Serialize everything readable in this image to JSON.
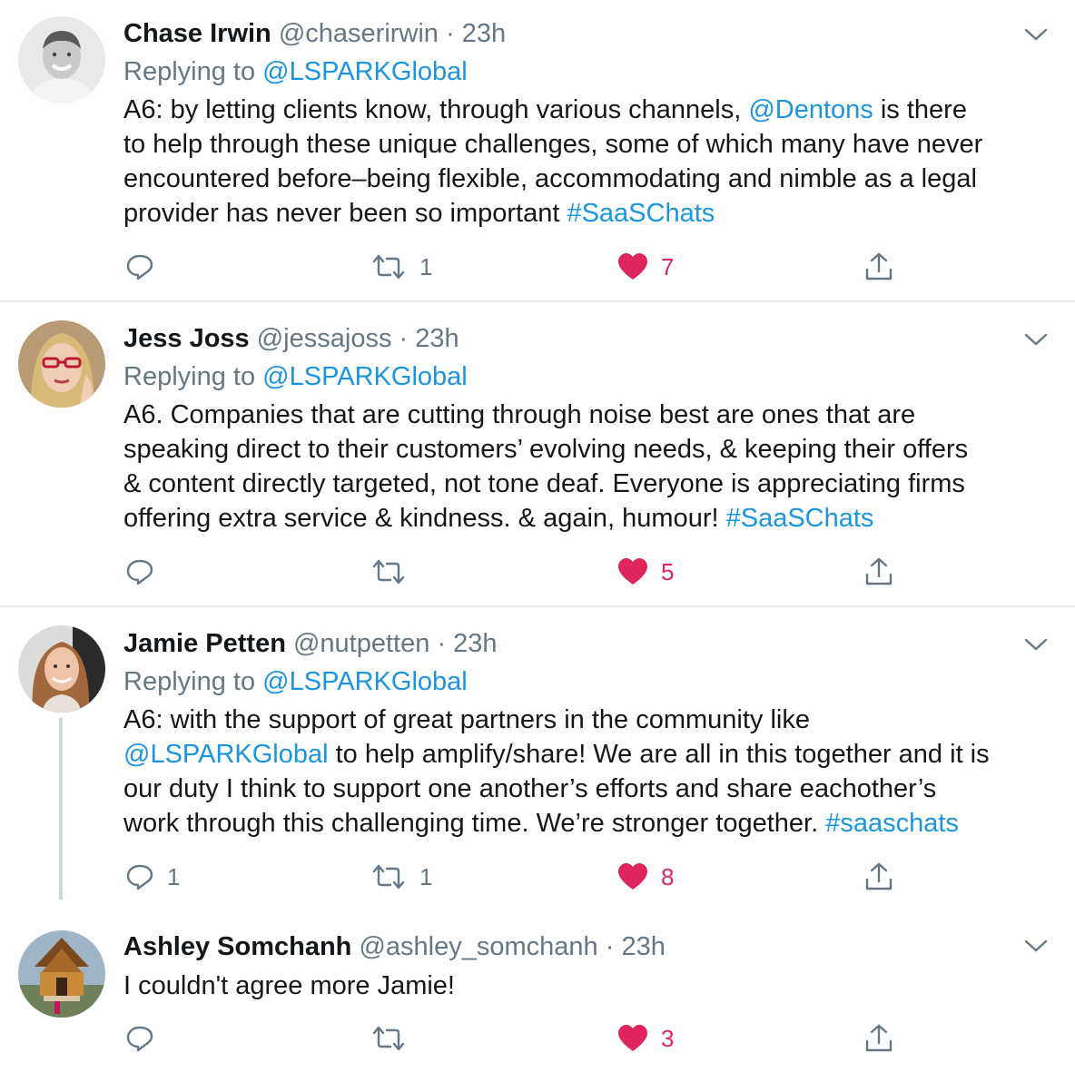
{
  "colors": {
    "link": "#1b95e0",
    "like": "#e0245e",
    "muted": "#657786",
    "divider": "#e6ecf0"
  },
  "tweets": [
    {
      "name": "Chase Irwin",
      "handle": "@chaserirwin",
      "dot": "·",
      "time": "23h",
      "replying_prefix": "Replying to ",
      "replying_handle": "@LSPARKGlobal",
      "avatar_icon": "avatar-photo-man-smiling",
      "lines": [
        [
          {
            "t": "A6: by letting clients know, through various channels, "
          },
          {
            "t": "@Dentons",
            "link": true
          },
          {
            "t": " is there"
          }
        ],
        [
          {
            "t": "to help through these unique challenges, some of which many have never"
          }
        ],
        [
          {
            "t": "encountered before–being flexible, accommodating and nimble as a legal"
          }
        ],
        [
          {
            "t": "provider has never been so important "
          },
          {
            "t": "#SaaSChats",
            "link": true
          }
        ]
      ],
      "replies": "",
      "retweets": "1",
      "likes": "7"
    },
    {
      "name": "Jess Joss",
      "handle": "@jessajoss",
      "dot": "·",
      "time": "23h",
      "replying_prefix": "Replying to ",
      "replying_handle": "@LSPARKGlobal",
      "avatar_icon": "avatar-photo-woman-red-glasses",
      "lines": [
        [
          {
            "t": "A6. Companies that are cutting through noise best are ones that are"
          }
        ],
        [
          {
            "t": "speaking direct to their customers’ evolving needs, & keeping their offers"
          }
        ],
        [
          {
            "t": "& content directly targeted, not tone deaf. Everyone is appreciating firms"
          }
        ],
        [
          {
            "t": "offering extra service & kindness. & again, humour! "
          },
          {
            "t": "#SaaSChats",
            "link": true
          }
        ]
      ],
      "replies": "",
      "retweets": "",
      "likes": "5"
    },
    {
      "name": "Jamie Petten",
      "handle": "@nutpetten",
      "dot": "·",
      "time": "23h",
      "replying_prefix": "Replying to ",
      "replying_handle": "@LSPARKGlobal",
      "avatar_icon": "avatar-photo-woman-long-hair",
      "lines": [
        [
          {
            "t": "A6: with the support of great partners in the community like"
          }
        ],
        [
          {
            "t": "@LSPARKGlobal",
            "link": true
          },
          {
            "t": " to help amplify/share! We are all in this together and it is"
          }
        ],
        [
          {
            "t": "our duty I think to support one another’s efforts and share eachother’s"
          }
        ],
        [
          {
            "t": "work through this challenging time. We’re stronger together. "
          },
          {
            "t": "#saaschats",
            "link": true
          }
        ]
      ],
      "replies": "1",
      "retweets": "1",
      "likes": "8"
    },
    {
      "name": "Ashley Somchanh",
      "handle": "@ashley_somchanh",
      "dot": "·",
      "time": "23h",
      "replying_prefix": "",
      "replying_handle": "",
      "avatar_icon": "avatar-photo-temple",
      "lines": [
        [
          {
            "t": "I couldn't agree more Jamie!"
          }
        ]
      ],
      "replies": "",
      "retweets": "",
      "likes": "3"
    }
  ],
  "icons": {
    "reply": "reply-icon",
    "retweet": "retweet-icon",
    "like": "heart-icon",
    "share": "share-icon",
    "menu": "chevron-down-icon"
  }
}
